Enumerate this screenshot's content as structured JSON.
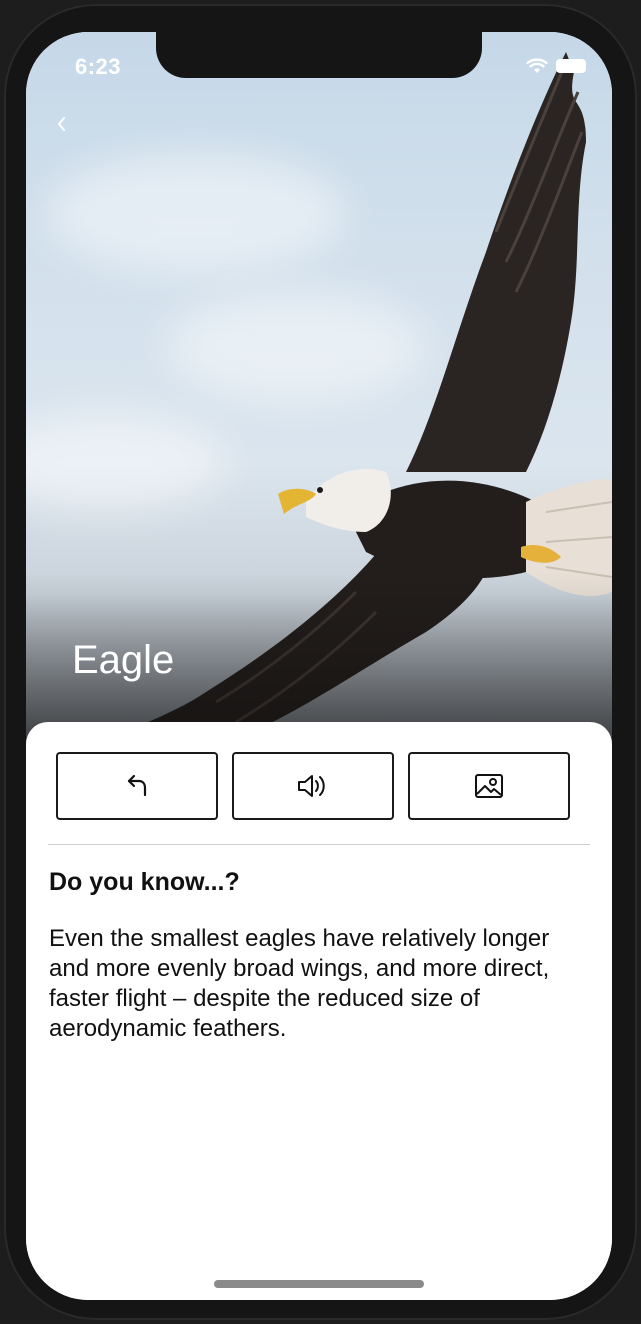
{
  "status_bar": {
    "time": "6:23",
    "icons": [
      "wifi-icon",
      "battery-icon"
    ]
  },
  "hero": {
    "title": "Eagle",
    "back_icon": "chevron-left-icon",
    "image_subject": "bald-eagle-photo"
  },
  "actions": [
    {
      "icon": "undo-arrow-icon"
    },
    {
      "icon": "speaker-icon"
    },
    {
      "icon": "image-icon"
    }
  ],
  "fact": {
    "heading": "Do you know...?",
    "body": "Even the smallest eagles have relatively longer and more evenly broad wings, and more direct, faster flight – despite the reduced size of aerodynamic feathers."
  },
  "colors": {
    "card_bg": "#ffffff",
    "text": "#111111",
    "button_border": "#1a1a1a",
    "sky": "#d2e0ec"
  }
}
